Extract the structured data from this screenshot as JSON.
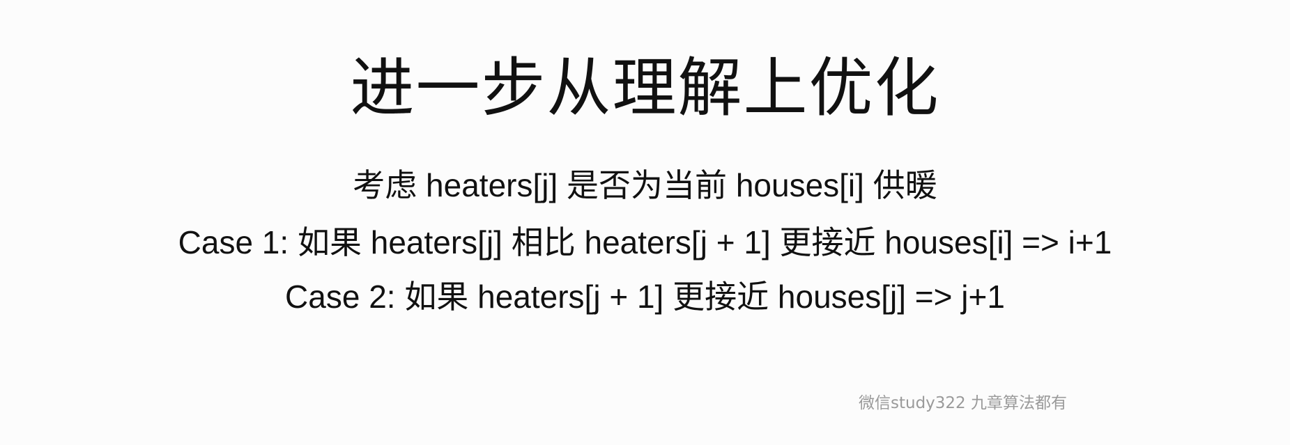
{
  "slide": {
    "title": "进一步从理解上优化",
    "lines": [
      "考虑 heaters[j] 是否为当前 houses[i] 供暖",
      "Case 1: 如果 heaters[j] 相比 heaters[j + 1] 更接近 houses[i] => i+1",
      "Case 2: 如果 heaters[j + 1] 更接近 houses[j] => j+1"
    ],
    "watermark": "微信study322 九章算法都有"
  },
  "colors": {
    "background": "#fcfcfc",
    "text": "#111111",
    "watermark": "#9a9a9a"
  }
}
